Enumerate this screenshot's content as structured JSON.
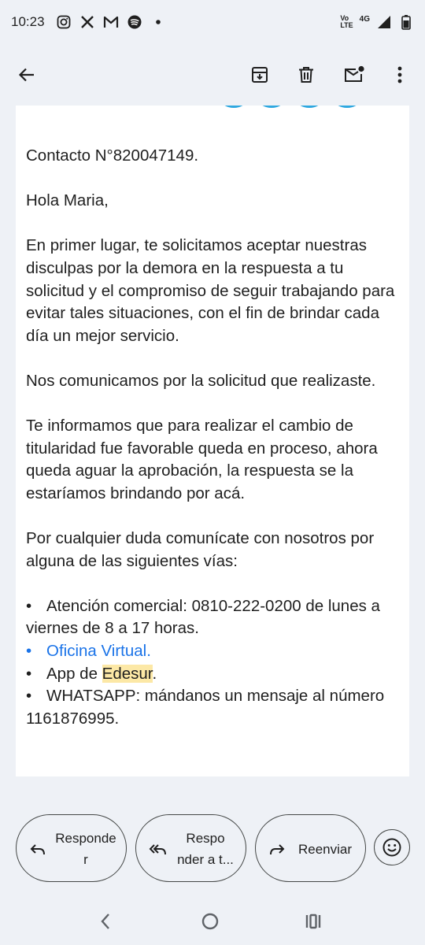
{
  "status_bar": {
    "time": "10:23",
    "icons": [
      "instagram-icon",
      "x-icon",
      "gmail-icon",
      "spotify-icon",
      "dot-icon"
    ],
    "network_top": "Vo",
    "network_bottom": "LTE",
    "network_gen": "4G"
  },
  "app_bar": {
    "icons": [
      "back-arrow-icon",
      "archive-icon",
      "delete-icon",
      "mark-unread-icon",
      "more-vert-icon"
    ]
  },
  "email": {
    "contact": "Contacto N°820047149.",
    "greeting": "Hola Maria,",
    "para1": "En primer lugar, te solicitamos aceptar nuestras disculpas por la demora en la respuesta a tu solicitud y el compromiso de seguir trabajando para evitar tales situaciones, con el fin de brindar cada día un mejor servicio.",
    "para2": "Nos comunicamos por la solicitud que realizaste.",
    "para3": "Te informamos que para realizar el cambio de titularidad fue favorable queda en proceso, ahora queda aguar la aprobación, la respuesta se la estaríamos brindando por acá.",
    "para4": "Por cualquier duda comunícate con nosotros por alguna de las siguientes vías:",
    "bullet_char": "•",
    "bullet1": "Atención comercial: 0810-222-0200 de lunes a viernes de 8 a 17 horas.",
    "bullet2_link": "Oficina Virtual.",
    "bullet3_prefix": "App de ",
    "bullet3_highlight": "Edesur",
    "bullet3_suffix": ".",
    "bullet4": "WHATSAPP:  mándanos un mensaje al número 1161876995."
  },
  "actions": {
    "reply_line1": "Responde",
    "reply_line2": "r",
    "reply_all_line1": "Respo",
    "reply_all_line2": "nder a t...",
    "forward": "Reenviar"
  },
  "colors": {
    "link": "#1a73e8",
    "highlight": "#fce8a6",
    "background": "#eef1f6",
    "logo_blue": "#2fa8e0"
  }
}
